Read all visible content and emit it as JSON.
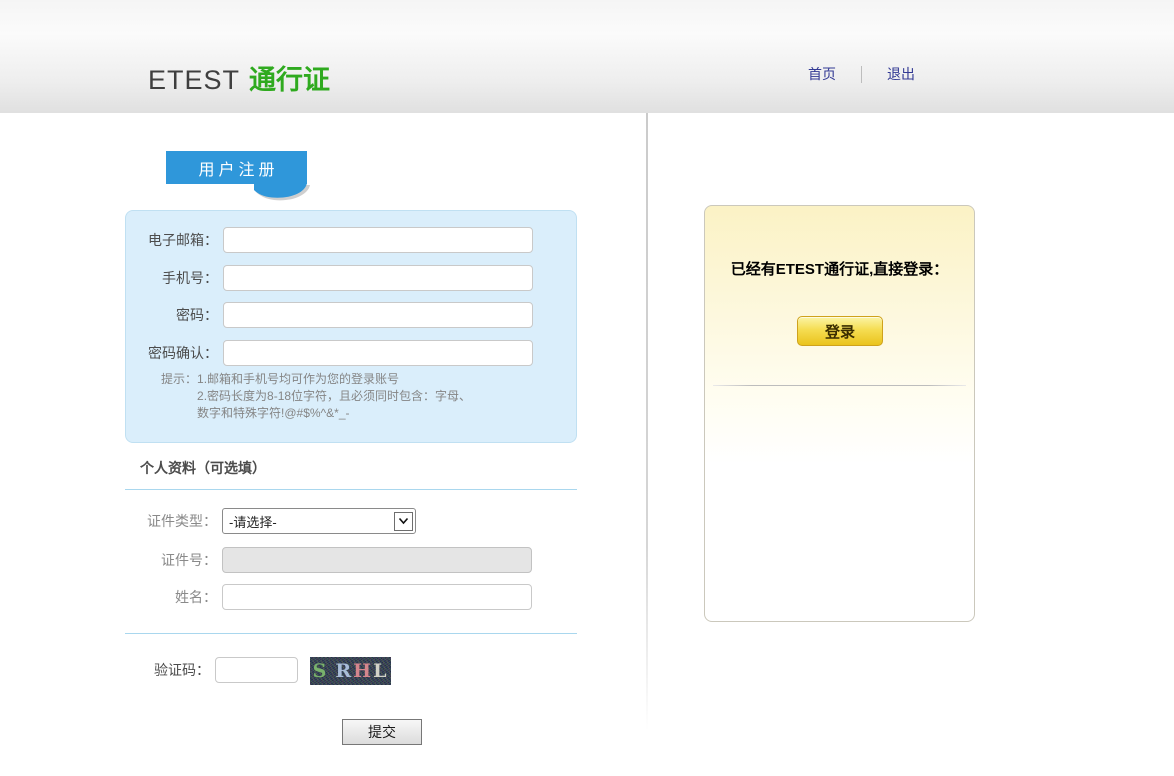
{
  "header": {
    "logo": {
      "primary": "ETEST",
      "secondary": "通行证"
    },
    "nav": {
      "home": "首页",
      "logout": "退出"
    }
  },
  "register": {
    "tab": "用户注册",
    "account": {
      "email_label": "电子邮箱：",
      "email_value": "",
      "mobile_label": "手机号：",
      "mobile_value": "",
      "password_label": "密码：",
      "password_value": "",
      "confirm_label": "密码确认：",
      "confirm_value": ""
    },
    "tips": {
      "prefix": "提示：",
      "lines": [
        "1.邮箱和手机号均可作为您的登录账号",
        "2.密码长度为8-18位字符，且必须同时包含：字母、",
        "数字和特殊字符!@#$%^&*_-"
      ]
    },
    "profile": {
      "heading": "个人资料（可选填）",
      "id_type_label": "证件类型：",
      "id_type_selected": "-请选择-",
      "id_number_label": "证件号：",
      "id_number_value": "",
      "name_label": "姓名：",
      "name_value": ""
    },
    "captcha": {
      "label": "验证码：",
      "value": "",
      "letters": [
        {
          "char": "S",
          "color": "#79b26b"
        },
        {
          "char": "R",
          "color": "#a9bdd8"
        },
        {
          "char": "H",
          "color": "#d4868d"
        },
        {
          "char": "L",
          "color": "#d2d2c8"
        }
      ]
    },
    "submit": "提交"
  },
  "login_panel": {
    "message": "已经有ETEST通行证,直接登录：",
    "button": "登录"
  },
  "colors": {
    "brand_green": "#2faa1f",
    "logo_gray": "#3f3f3f",
    "nav_link_blue": "#333a94",
    "tab_blue": "#2f97da",
    "form_box_bg": "#daeefb",
    "form_box_border": "#c0e0f2",
    "section_line_blue": "#a9d7ee",
    "panel_yellow_top": "#fbf2c5",
    "login_gold_top": "#fbf5a6",
    "login_gold_bottom": "#eac31d",
    "captcha_bg": "#2b3142"
  }
}
